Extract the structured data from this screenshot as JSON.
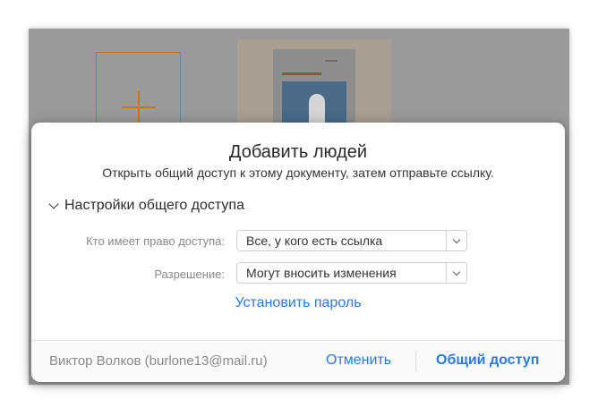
{
  "dialog": {
    "title": "Добавить людей",
    "subtitle": "Открыть общий доступ к этому документу, затем отправьте ссылку.",
    "section_title": "Настройки общего доступа",
    "access": {
      "label": "Кто имеет право доступа:",
      "value": "Все, у кого есть ссылка"
    },
    "permission": {
      "label": "Разрешение:",
      "value": "Могут вносить изменения"
    },
    "set_password": "Установить пароль"
  },
  "footer": {
    "owner": "Виктор Волков (burlone13@mail.ru)",
    "cancel": "Отменить",
    "share": "Общий доступ"
  },
  "colors": {
    "accent": "#2a7ae2",
    "backdrop": "#9a9a9a",
    "tile_border": "#b8741b"
  }
}
